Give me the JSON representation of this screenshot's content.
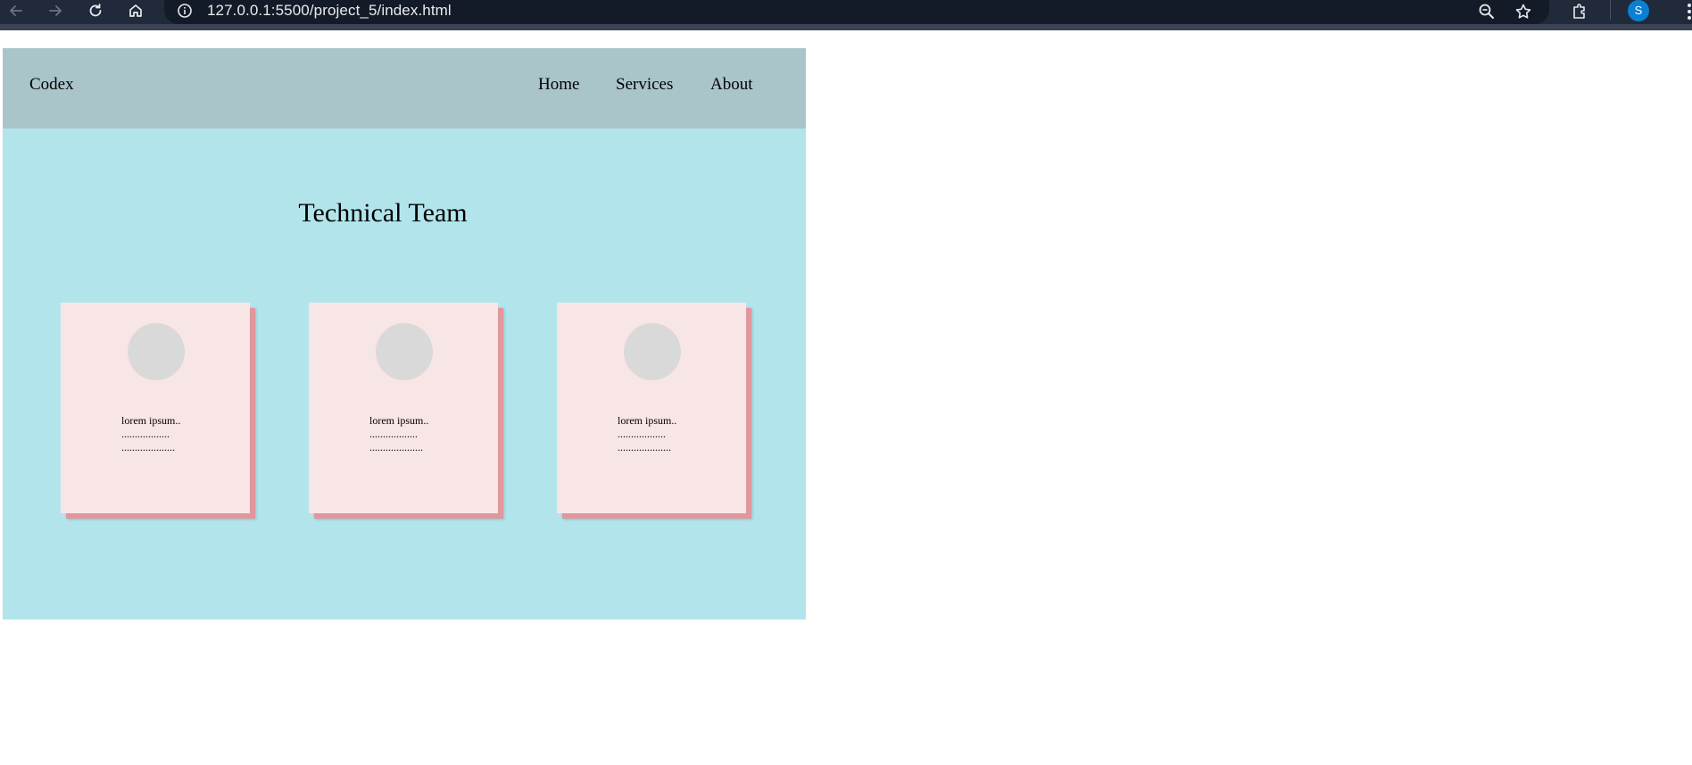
{
  "browser": {
    "url": "127.0.0.1:5500/project_5/index.html",
    "profile_initial": "S",
    "colors": {
      "toolbar": "#202a3b",
      "address_bar": "#141b28",
      "avatar": "#0b7fd4"
    },
    "icons": [
      "back-arrow-icon",
      "forward-arrow-icon",
      "reload-icon",
      "home-icon",
      "info-icon",
      "zoom-out-icon",
      "bookmark-star-icon",
      "extensions-icon",
      "more-menu-icon"
    ]
  },
  "page": {
    "header": {
      "logo": "Codex",
      "nav": [
        {
          "label": "Home"
        },
        {
          "label": "Services"
        },
        {
          "label": "About"
        }
      ]
    },
    "section_title": "Technical Team",
    "cards": [
      {
        "name": "lorem ipsum..",
        "line1": "..................",
        "line2": "...................."
      },
      {
        "name": "lorem ipsum..",
        "line1": "..................",
        "line2": "...................."
      },
      {
        "name": "lorem ipsum..",
        "line1": "..................",
        "line2": "...................."
      }
    ],
    "colors": {
      "header_bg": "#a9c5ca",
      "body_bg": "#b1e5eb",
      "card_bg": "#f8e5e6",
      "card_shadow": "#e0979d",
      "avatar_placeholder": "#d9d9d9"
    }
  }
}
